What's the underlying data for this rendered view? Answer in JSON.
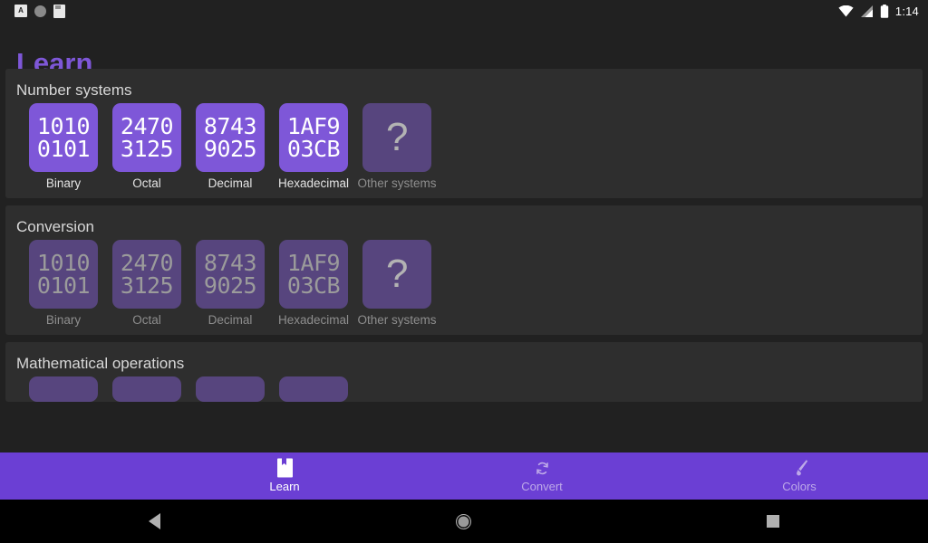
{
  "statusbar": {
    "notif_app_letter": "A",
    "notif_icons": [
      "app-badge-icon",
      "circle-icon",
      "document-icon"
    ],
    "signal_icons": [
      "wifi-icon",
      "cellular-signal-icon",
      "battery-icon"
    ],
    "time": "1:14"
  },
  "appbar": {
    "title": "Learn",
    "title_color": "#7E57D8"
  },
  "sections": [
    {
      "title": "Number systems",
      "enabled": true,
      "tiles": [
        {
          "line1": "1010",
          "line2": "0101",
          "label": "Binary",
          "dim": false,
          "glyph": null
        },
        {
          "line1": "2470",
          "line2": "3125",
          "label": "Octal",
          "dim": false,
          "glyph": null
        },
        {
          "line1": "8743",
          "line2": "9025",
          "label": "Decimal",
          "dim": false,
          "glyph": null
        },
        {
          "line1": "1AF9",
          "line2": "03CB",
          "label": "Hexadecimal",
          "dim": false,
          "glyph": null
        },
        {
          "line1": "",
          "line2": "",
          "label": "Other systems",
          "dim": true,
          "glyph": "?"
        }
      ]
    },
    {
      "title": "Conversion",
      "enabled": false,
      "tiles": [
        {
          "line1": "1010",
          "line2": "0101",
          "label": "Binary",
          "dim": true,
          "glyph": null
        },
        {
          "line1": "2470",
          "line2": "3125",
          "label": "Octal",
          "dim": true,
          "glyph": null
        },
        {
          "line1": "8743",
          "line2": "9025",
          "label": "Decimal",
          "dim": true,
          "glyph": null
        },
        {
          "line1": "1AF9",
          "line2": "03CB",
          "label": "Hexadecimal",
          "dim": true,
          "glyph": null
        },
        {
          "line1": "",
          "line2": "",
          "label": "Other systems",
          "dim": true,
          "glyph": "?"
        }
      ]
    },
    {
      "title": "Mathematical operations",
      "enabled": false,
      "clipped": true,
      "tiles": [
        {
          "line1": "",
          "line2": "",
          "label": "",
          "dim": true,
          "glyph": null
        },
        {
          "line1": "",
          "line2": "",
          "label": "",
          "dim": true,
          "glyph": null
        },
        {
          "line1": "",
          "line2": "",
          "label": "",
          "dim": true,
          "glyph": null
        },
        {
          "line1": "",
          "line2": "",
          "label": "",
          "dim": true,
          "glyph": null
        }
      ]
    }
  ],
  "bottomnav": {
    "background": "#6B3FD4",
    "items": [
      {
        "label": "Learn",
        "icon": "bookmark-icon",
        "active": true
      },
      {
        "label": "Convert",
        "icon": "sync-icon",
        "active": false
      },
      {
        "label": "Colors",
        "icon": "paintbrush-icon",
        "active": false
      }
    ]
  },
  "sysnav": {
    "buttons": [
      "back-triangle-icon",
      "home-circle-icon",
      "recents-square-icon"
    ]
  },
  "theme": {
    "page_bg": "#212121",
    "card_bg": "#2E2E2E",
    "tile_accent": "#7E57D8",
    "tile_dim": "#57457E"
  }
}
